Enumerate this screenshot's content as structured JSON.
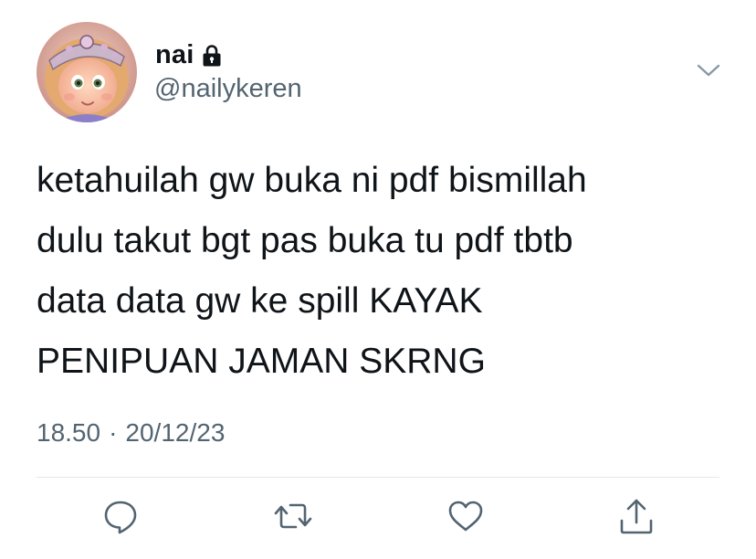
{
  "tweet": {
    "author": {
      "display_name": "nai",
      "handle": "@nailykeren",
      "locked_icon": "lock-icon",
      "avatar": "avatar-princess-crown"
    },
    "text_lines": [
      "ketahuilah gw buka ni pdf bismillah",
      "dulu takut bgt pas buka tu pdf tbtb",
      "data data gw ke spill KAYAK",
      "PENIPUAN JAMAN SKRNG"
    ],
    "time": "18.50",
    "separator": "·",
    "date": "20/12/23",
    "menu_icon": "chevron-down-icon",
    "actions": [
      "reply-icon",
      "retweet-icon",
      "like-icon",
      "share-icon"
    ]
  },
  "colors": {
    "text": "#0f1419",
    "secondary": "#536471",
    "divider": "#e1e8ed",
    "icon": "#536471"
  }
}
